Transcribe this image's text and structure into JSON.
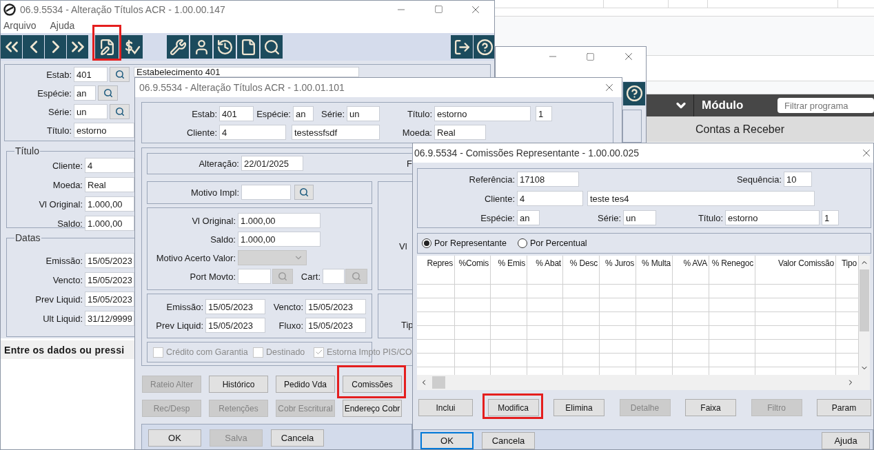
{
  "background_app": {
    "module_label": "Módulo",
    "filter": {
      "placeholder": "Filtrar programa"
    },
    "module_item": "Contas a Receber"
  },
  "main_window": {
    "title": "06.9.5534 - Alteração Títulos ACR - 1.00.00.147",
    "menu": [
      "Arquivo",
      "Ajuda"
    ],
    "toolbar": [
      {
        "kind": "first",
        "highlighted": false
      },
      {
        "kind": "previous",
        "highlighted": false
      },
      {
        "kind": "next",
        "highlighted": false
      },
      {
        "kind": "last",
        "highlighted": false
      },
      {
        "kind": "edit",
        "highlighted": true
      },
      {
        "kind": "payment",
        "highlighted": false
      },
      {
        "kind": "tools",
        "highlighted": false
      },
      {
        "kind": "user",
        "highlighted": false
      },
      {
        "kind": "history",
        "highlighted": false
      },
      {
        "kind": "document",
        "highlighted": false
      },
      {
        "kind": "search",
        "highlighted": false
      },
      {
        "kind": "exit",
        "highlighted": false
      },
      {
        "kind": "help",
        "highlighted": false
      }
    ],
    "header_rows": [
      [
        {
          "kind": "field",
          "label": "Estab:",
          "value": "401"
        },
        {
          "kind": "lookup",
          "disabled": false
        },
        {
          "kind": "field",
          "value": "Estabelecimento 401"
        }
      ],
      [
        {
          "kind": "field",
          "label": "Espécie:",
          "value": "an"
        },
        {
          "kind": "lookup",
          "disabled": false
        }
      ],
      [
        {
          "kind": "field",
          "label": "Série:",
          "value": "un"
        },
        {
          "kind": "lookup",
          "disabled": false
        }
      ],
      [
        {
          "kind": "field",
          "label": "Título:",
          "value": "estorno"
        }
      ]
    ],
    "titulo_group": {
      "legend": "Título",
      "fields": [
        {
          "label": "Cliente:",
          "value": "4"
        },
        {
          "label": "Moeda:",
          "value": "Real"
        },
        {
          "label": "Vl Original:",
          "value": "1.000,00"
        },
        {
          "label": "Saldo:",
          "value": "1.000,00"
        }
      ]
    },
    "datas_group": {
      "legend": "Datas",
      "fields": [
        {
          "label": "Emissão:",
          "value": "15/05/2023"
        },
        {
          "label": "Vencto:",
          "value": "15/05/2023"
        },
        {
          "label": "Prev Liquid:",
          "value": "15/05/2023"
        },
        {
          "label": "Ult Liquid:",
          "value": "31/12/9999"
        }
      ]
    },
    "status": "Entre os dados ou pressi"
  },
  "edit_window": {
    "title": "06.9.5534 - Alteração Títulos ACR - 1.00.01.101",
    "header_rows": [
      [
        {
          "kind": "field",
          "label": "Estab:",
          "value": "401"
        },
        {
          "kind": "field",
          "label": "Espécie:",
          "value": "an"
        },
        {
          "kind": "field",
          "label": "Série:",
          "value": "un"
        },
        {
          "kind": "field",
          "label": "Título:",
          "value": "estorno"
        },
        {
          "kind": "field",
          "value": "1"
        }
      ],
      [
        {
          "kind": "field",
          "label": "Cliente:",
          "value": "4"
        },
        {
          "kind": "field",
          "value": "testessfsdf"
        },
        {
          "kind": "field",
          "label": "Moeda:",
          "value": "Real"
        }
      ]
    ],
    "alteracao_row": [
      {
        "kind": "field",
        "label": "Alteração:",
        "value": "22/01/2025"
      },
      {
        "kind": "text",
        "label": "F"
      }
    ],
    "motivo_row": [
      {
        "kind": "field",
        "label": "Motivo Impl:"
      },
      {
        "kind": "lookup",
        "disabled": false
      }
    ],
    "value_rows": [
      [
        {
          "kind": "field",
          "label": "Vl Original:",
          "value": "1.000,00"
        }
      ],
      [
        {
          "kind": "field",
          "label": "Saldo:",
          "value": "1.000,00"
        }
      ],
      [
        {
          "kind": "select",
          "label": "Motivo Acerto Valor:",
          "disabled": true
        }
      ],
      [
        {
          "kind": "field",
          "label": "Port Movto:"
        },
        {
          "kind": "lookup",
          "disabled": true
        },
        {
          "kind": "field",
          "label": "Cart:"
        },
        {
          "kind": "lookup",
          "disabled": true
        }
      ]
    ],
    "date_rows": [
      [
        {
          "kind": "field",
          "label": "Emissão:",
          "value": "15/05/2023"
        },
        {
          "kind": "field",
          "label": "Vencto:",
          "value": "15/05/2023"
        }
      ],
      [
        {
          "kind": "field",
          "label": "Prev Liquid:",
          "value": "15/05/2023"
        },
        {
          "kind": "field",
          "label": "Fluxo:",
          "value": "15/05/2023"
        }
      ]
    ],
    "checkboxes": [
      {
        "label": "Crédito com Garantia",
        "checked": false,
        "disabled": true
      },
      {
        "label": "Destinado",
        "checked": false,
        "disabled": true
      },
      {
        "label": "Estorna Impto PIS/CO",
        "checked": true,
        "disabled": true
      }
    ],
    "side_labels": [
      "Vl",
      "Tip"
    ],
    "action_rows": [
      [
        {
          "label": "Rateio Alter",
          "disabled": true,
          "highlighted": false
        },
        {
          "label": "Histórico",
          "disabled": false,
          "highlighted": false
        },
        {
          "label": "Pedido Vda",
          "disabled": false,
          "highlighted": false
        },
        {
          "label": "Comissões",
          "disabled": false,
          "highlighted": true
        }
      ],
      [
        {
          "label": "Rec/Desp",
          "disabled": true,
          "highlighted": false
        },
        {
          "label": "Retenções",
          "disabled": true,
          "highlighted": false
        },
        {
          "label": "Cobr Escritural",
          "disabled": true,
          "highlighted": false
        },
        {
          "label": "Endereço Cobr",
          "disabled": false,
          "highlighted": false
        }
      ]
    ],
    "footer_buttons": [
      {
        "label": "OK",
        "disabled": false
      },
      {
        "label": "Salva",
        "disabled": true
      },
      {
        "label": "Cancela",
        "disabled": false
      }
    ]
  },
  "commission_window": {
    "title": "06.9.5534 - Comissões Representante - 1.00.00.025",
    "header_rows": [
      [
        {
          "kind": "field",
          "label": "Referência:",
          "value": "17108"
        },
        {
          "kind": "field",
          "label": "Sequência:",
          "value": "10"
        }
      ],
      [
        {
          "kind": "field",
          "label": "Cliente:",
          "value": "4"
        },
        {
          "kind": "field",
          "value": "teste tes4"
        }
      ],
      [
        {
          "kind": "field",
          "label": "Espécie:",
          "value": "an"
        },
        {
          "kind": "field",
          "label": "Série:",
          "value": "un"
        },
        {
          "kind": "field",
          "label": "Título:",
          "value": "estorno"
        },
        {
          "kind": "field",
          "value": "1"
        }
      ]
    ],
    "mode_options": [
      {
        "label": "Por Representante",
        "selected": true
      },
      {
        "label": "Por Percentual",
        "selected": false
      }
    ],
    "table": {
      "columns": [
        "Repres",
        "%Comis",
        "% Emis",
        "% Abat",
        "% Desc",
        "% Juros",
        "% Multa",
        "% AVA",
        "% Renegoc",
        "Valor Comissão",
        "Tipo"
      ]
    },
    "action_buttons": [
      {
        "label": "Inclui",
        "disabled": false,
        "highlighted": false
      },
      {
        "label": "Modifica",
        "disabled": false,
        "highlighted": true
      },
      {
        "label": "Elimina",
        "disabled": false,
        "highlighted": false
      },
      {
        "label": "Detalhe",
        "disabled": true,
        "highlighted": false
      },
      {
        "label": "Faixa",
        "disabled": false,
        "highlighted": false
      },
      {
        "label": "Filtro",
        "disabled": true,
        "highlighted": false
      },
      {
        "label": "Param",
        "disabled": false,
        "highlighted": false
      }
    ],
    "footer_buttons": [
      {
        "label": "OK",
        "default": true
      },
      {
        "label": "Cancela",
        "default": false
      },
      {
        "label": "Ajuda",
        "default": false
      }
    ]
  }
}
